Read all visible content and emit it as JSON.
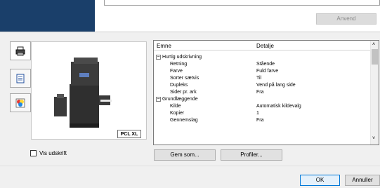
{
  "top": {
    "apply_label": "Anvend"
  },
  "preview": {
    "badge": "PCL XL"
  },
  "grid": {
    "header": {
      "col1": "Emne",
      "col2": "Detalje"
    },
    "rows": [
      {
        "label": "Hurtig udskrivning",
        "value": "",
        "group": true
      },
      {
        "label": "Retning",
        "value": "Stående"
      },
      {
        "label": "Farve",
        "value": "Fuld farve"
      },
      {
        "label": "Sorter sætvis",
        "value": "Til"
      },
      {
        "label": "Dupleks",
        "value": "Vend på lang side"
      },
      {
        "label": "Sider pr. ark",
        "value": "Fra"
      },
      {
        "label": "Grundlæggende",
        "value": "",
        "group": true
      },
      {
        "label": "Kilde",
        "value": "Automatisk kildevalg"
      },
      {
        "label": "Kopier",
        "value": "1"
      },
      {
        "label": "Gennemslag",
        "value": "Fra"
      }
    ]
  },
  "footer": {
    "show_printout_label": "Vis udskrift",
    "save_as_label": "Gem som...",
    "profiles_label": "Profiler...",
    "ok_label": "OK",
    "cancel_label": "Annuller"
  }
}
